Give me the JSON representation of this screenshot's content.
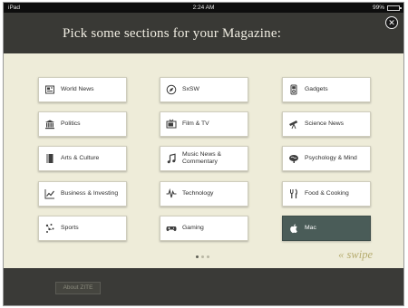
{
  "status_bar": {
    "device": "iPad",
    "time": "2:24 AM",
    "battery": "99%"
  },
  "header": {
    "title": "Pick some sections for your Magazine:"
  },
  "sections": [
    {
      "label": "World News",
      "icon": "newspaper-icon",
      "selected": false
    },
    {
      "label": "SxSW",
      "icon": "compass-icon",
      "selected": false
    },
    {
      "label": "Gadgets",
      "icon": "ipod-icon",
      "selected": false
    },
    {
      "label": "Politics",
      "icon": "capitol-icon",
      "selected": false
    },
    {
      "label": "Film & TV",
      "icon": "tv-icon",
      "selected": false
    },
    {
      "label": "Science News",
      "icon": "telescope-icon",
      "selected": false
    },
    {
      "label": "Arts & Culture",
      "icon": "book-icon",
      "selected": false
    },
    {
      "label": "Music News & Commentary",
      "icon": "music-note-icon",
      "selected": false
    },
    {
      "label": "Psychology & Mind",
      "icon": "brain-icon",
      "selected": false
    },
    {
      "label": "Business & Investing",
      "icon": "chart-icon",
      "selected": false
    },
    {
      "label": "Technology",
      "icon": "waveform-icon",
      "selected": false
    },
    {
      "label": "Food & Cooking",
      "icon": "fork-knife-icon",
      "selected": false
    },
    {
      "label": "Sports",
      "icon": "sports-icon",
      "selected": false
    },
    {
      "label": "Gaming",
      "icon": "gamepad-icon",
      "selected": false
    },
    {
      "label": "Mac",
      "icon": "apple-icon",
      "selected": true
    }
  ],
  "pager": {
    "current": 1,
    "total": 3
  },
  "swipe_hint": "« swipe",
  "footer": {
    "about_label": "About ZITE"
  },
  "colors": {
    "header_bg": "#393935",
    "content_bg": "#eeecd9",
    "selected_tile": "#4a5c58",
    "swipe_text": "#b6ac6f"
  }
}
